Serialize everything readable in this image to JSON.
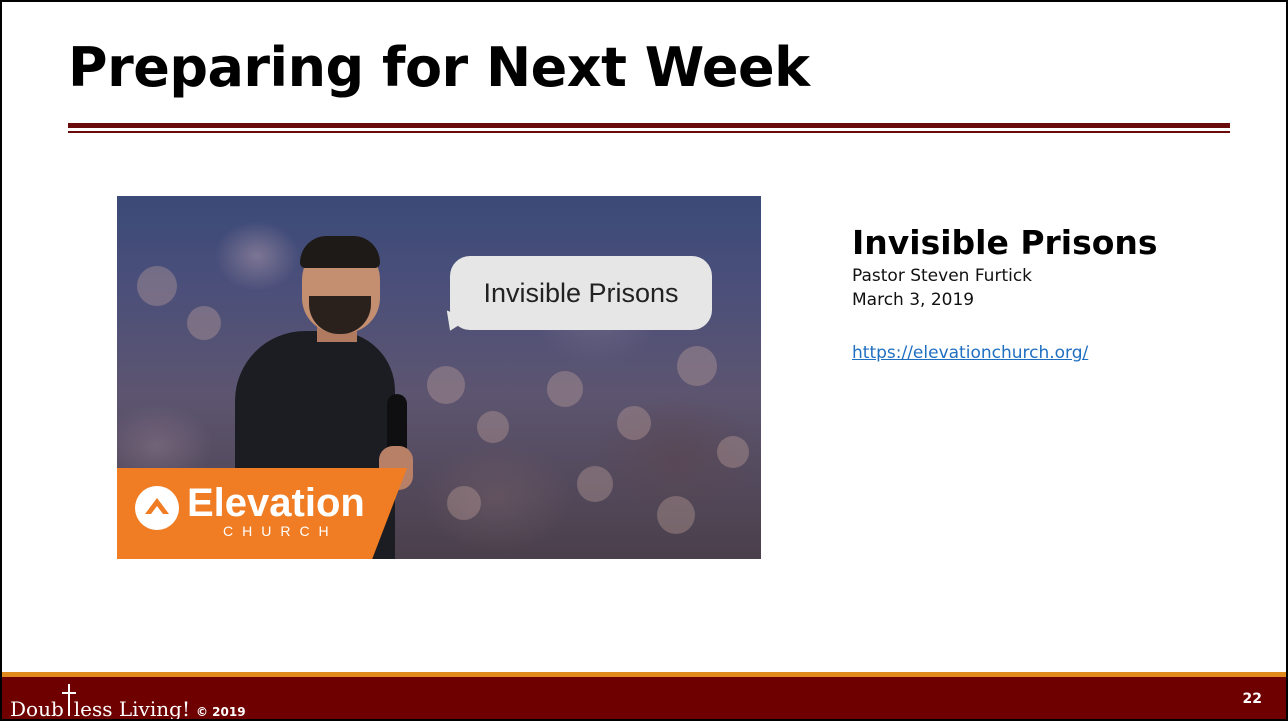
{
  "slide": {
    "title": "Preparing for Next Week",
    "page_number": "22"
  },
  "thumbnail": {
    "bubble_text": "Invisible Prisons",
    "brand_name": "Elevation",
    "brand_sub": "CHURCH",
    "logo_icon": "chevron-up-icon"
  },
  "sermon": {
    "title": "Invisible Prisons",
    "speaker": "Pastor Steven Furtick",
    "date": "March 3, 2019",
    "link_text": "https://elevationchurch.org/"
  },
  "footer": {
    "brand_before": "Doub",
    "brand_after": "less Living!",
    "copyright": "© 2019"
  },
  "colors": {
    "title_rule": "#6b0a0a",
    "footer_bar": "#6e0000",
    "footer_accent": "#e08a1e",
    "brand_orange": "#f07c23",
    "link": "#1f6fc1"
  }
}
